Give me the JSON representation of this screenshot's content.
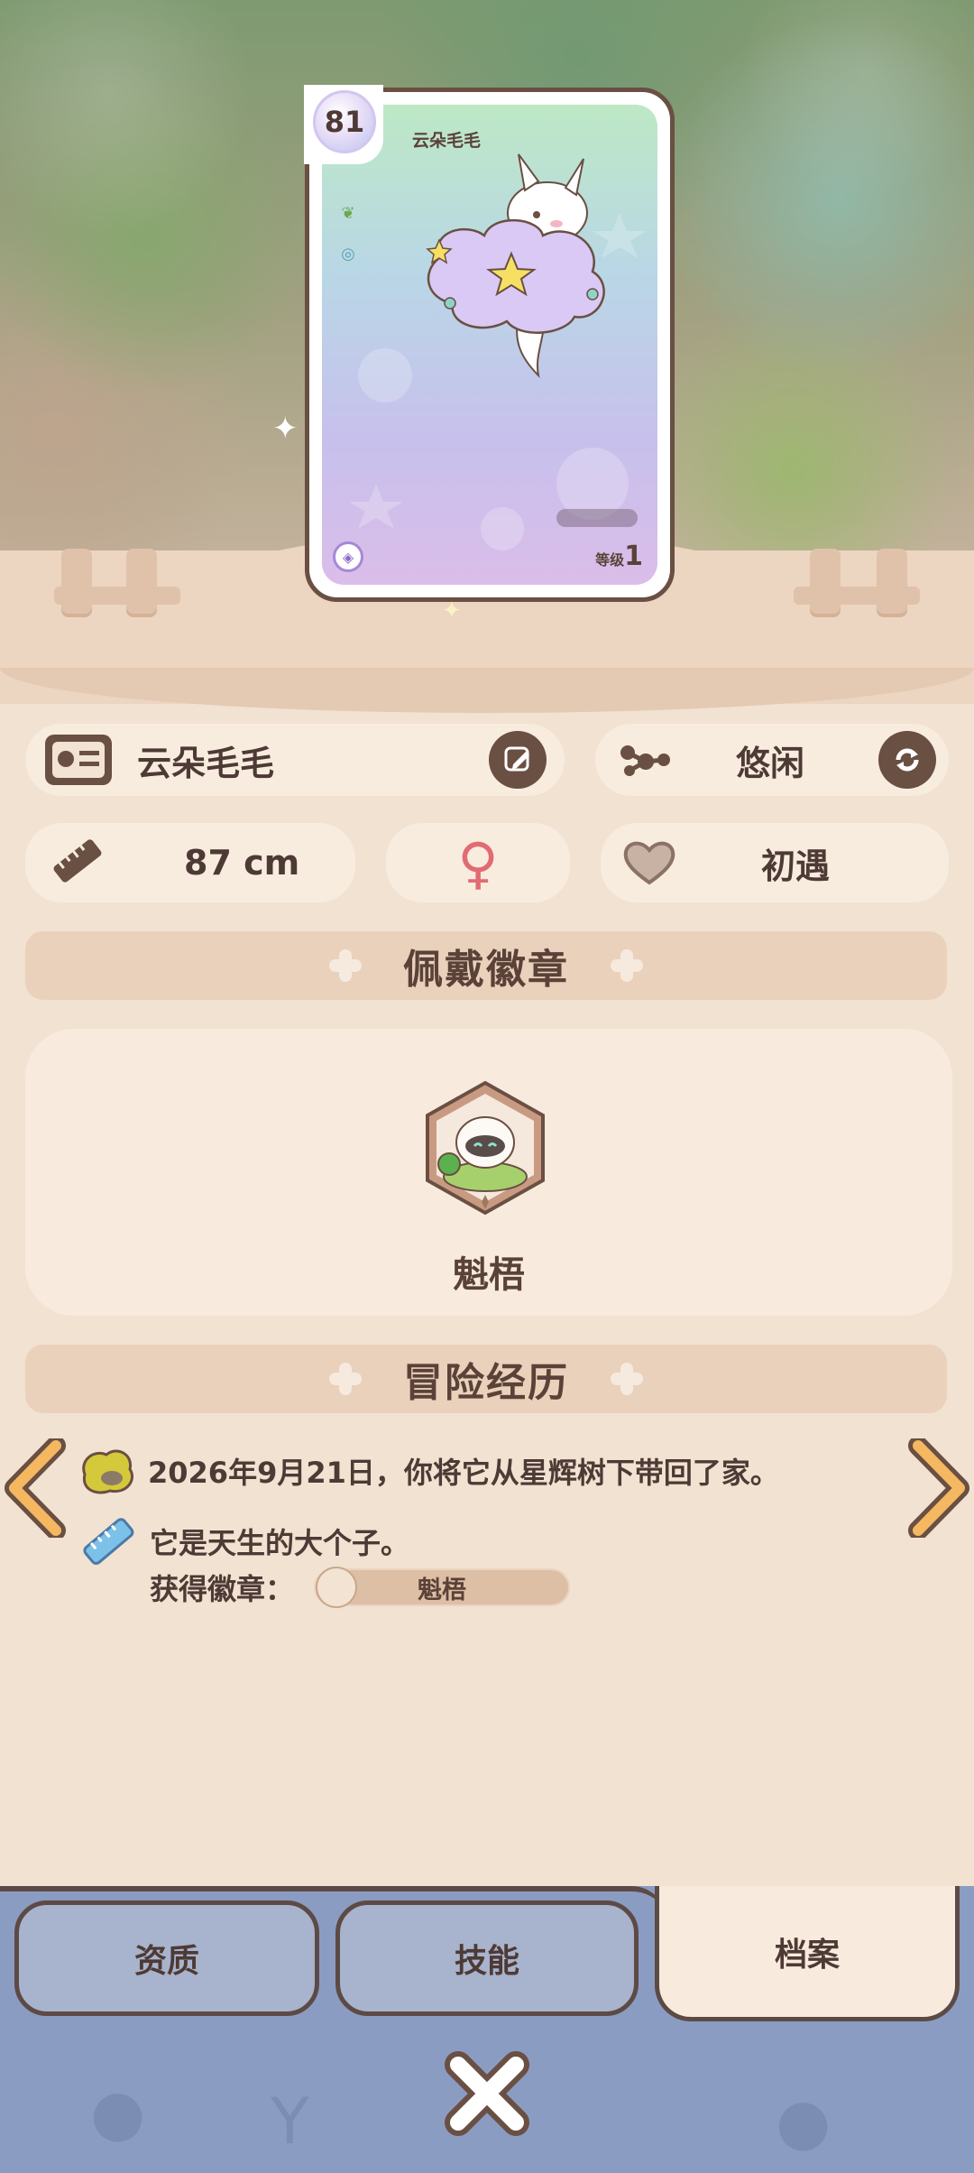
{
  "card": {
    "level_badge": "81",
    "name": "云朵毛毛",
    "level_label": "等级",
    "level_value": "1"
  },
  "info": {
    "name": "云朵毛毛",
    "personality": "悠闲",
    "height": "87 cm",
    "gender_symbol": "♀",
    "relationship": "初遇"
  },
  "sections": {
    "badge_title": "佩戴徽章",
    "adventure_title": "冒险经历"
  },
  "badge": {
    "name": "魁梧"
  },
  "adventure": {
    "entry1": "2026年9月21日，你将它从星辉树下带回了家。",
    "entry2": "它是天生的大个子。",
    "badge_label": "获得徽章：",
    "badge_name": "魁梧"
  },
  "tabs": {
    "aptitude": "资质",
    "skills": "技能",
    "profile": "档案"
  },
  "colors": {
    "accent_brown": "#6a4f43",
    "tab_blue": "#8b9cc3",
    "panel_cream": "#f8ebdd"
  }
}
